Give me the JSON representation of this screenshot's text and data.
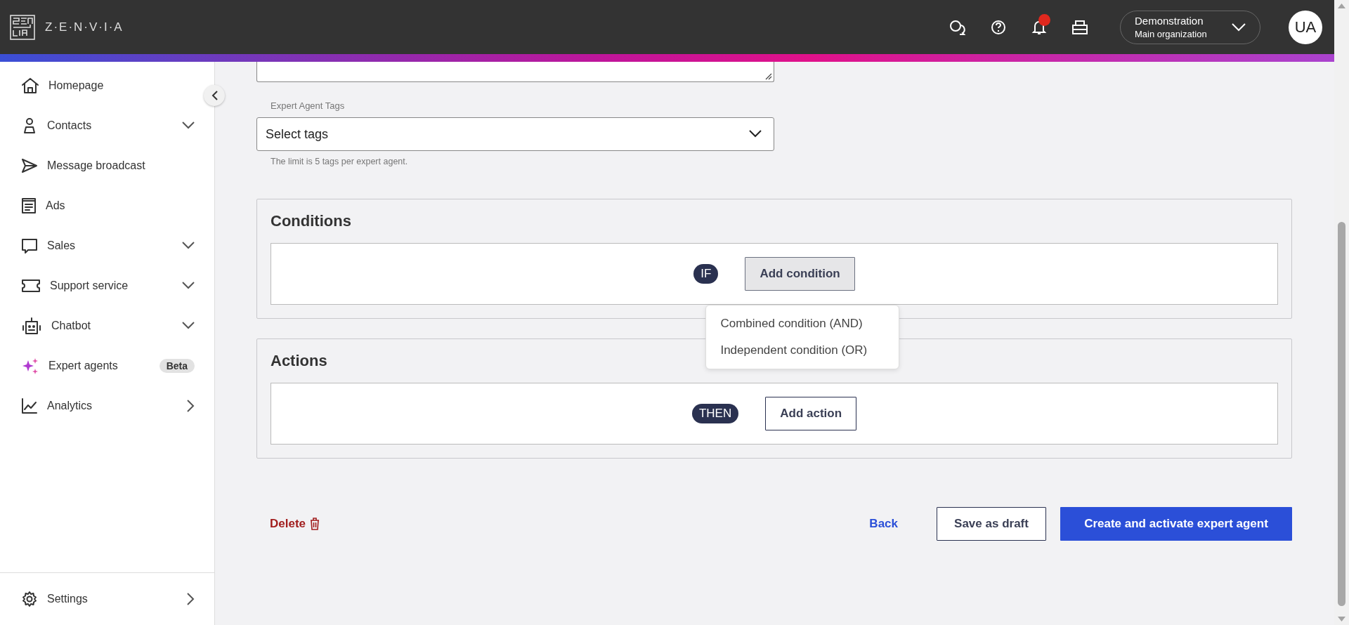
{
  "header": {
    "logo_text": "Z·E·N·V·I·A",
    "notifications_unread": true,
    "org": {
      "name": "Demonstration",
      "subtitle": "Main organization"
    },
    "avatar": "UA"
  },
  "sidebar": {
    "items": [
      {
        "label": "Homepage",
        "kind": "link"
      },
      {
        "label": "Contacts",
        "kind": "expandable"
      },
      {
        "label": "Message broadcast",
        "kind": "link"
      },
      {
        "label": "Ads",
        "kind": "link"
      },
      {
        "label": "Sales",
        "kind": "expandable"
      },
      {
        "label": "Support service",
        "kind": "expandable"
      },
      {
        "label": "Chatbot",
        "kind": "expandable"
      },
      {
        "label": "Expert agents",
        "kind": "link",
        "badge": "Beta"
      },
      {
        "label": "Analytics",
        "kind": "submenu"
      }
    ],
    "footer": {
      "label": "Settings",
      "kind": "submenu"
    }
  },
  "form": {
    "tags": {
      "label": "Expert Agent Tags",
      "placeholder": "Select tags",
      "hint": "The limit is 5 tags per expert agent."
    },
    "sections": [
      {
        "title": "Conditions",
        "operator": "IF",
        "button": "Add condition",
        "expanded": true,
        "menu": [
          "Combined condition (AND)",
          "Independent condition (OR)"
        ]
      },
      {
        "title": "Actions",
        "operator": "THEN",
        "button": "Add action",
        "expanded": false
      }
    ],
    "footer": {
      "delete": "Delete",
      "back": "Back",
      "draft": "Save as draft",
      "submit": "Create and activate expert agent"
    }
  }
}
